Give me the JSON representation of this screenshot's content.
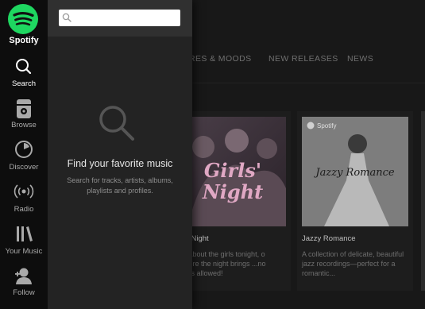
{
  "nav": {
    "logo_text": "Spotify",
    "items": [
      {
        "label": "Search",
        "icon": "search-icon"
      },
      {
        "label": "Browse",
        "icon": "browse-icon"
      },
      {
        "label": "Discover",
        "icon": "discover-icon"
      },
      {
        "label": "Radio",
        "icon": "radio-icon"
      },
      {
        "label": "Your Music",
        "icon": "library-icon"
      },
      {
        "label": "Follow",
        "icon": "follow-icon"
      }
    ]
  },
  "search_panel": {
    "query": "",
    "empty_title": "Find your favorite music",
    "empty_text": "Search for tracks, artists, albums, playlists and profiles."
  },
  "browse": {
    "tabs": [
      "URES & MOODS",
      "NEW RELEASES",
      "NEWS"
    ],
    "cards": [
      {
        "art_text": "Girls' Night",
        "title": "rls' Night",
        "description": "all about the girls tonight, o where the night brings ...no boys allowed!"
      },
      {
        "art_brand": "Spotify",
        "art_text": "Jazzy Romance",
        "title": "Jazzy Romance",
        "description": "A collection of delicate, beautiful jazz recordings—perfect for a romantic..."
      }
    ]
  },
  "colors": {
    "accent": "#1ed760",
    "rail": "#0d0d0d",
    "drawer": "#232323",
    "drawer_head": "#303030"
  }
}
